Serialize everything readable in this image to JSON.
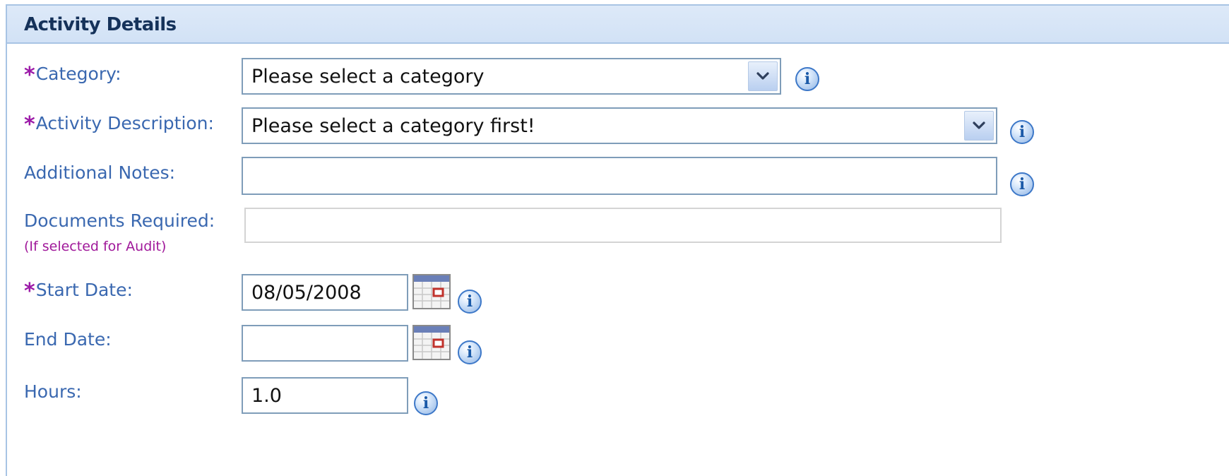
{
  "panel": {
    "title": "Activity Details"
  },
  "fields": {
    "category": {
      "required_mark": "*",
      "label": "Category:",
      "value": "Please select a category"
    },
    "activity_description": {
      "required_mark": "*",
      "label": "Activity Description:",
      "value": "Please select a category first!"
    },
    "additional_notes": {
      "label": "Additional Notes:",
      "value": ""
    },
    "documents_required": {
      "label": "Documents Required:",
      "sublabel": "(If selected for Audit)",
      "value": ""
    },
    "start_date": {
      "required_mark": "*",
      "label": "Start Date:",
      "value": "08/05/2008"
    },
    "end_date": {
      "label": "End Date:",
      "value": ""
    },
    "hours": {
      "label": "Hours:",
      "value": "1.0"
    }
  },
  "icons": {
    "info": "info-icon",
    "calendar": "calendar-icon",
    "dropdown": "chevron-down-icon",
    "info_glyph": "i"
  },
  "colors": {
    "label": "#3a68b0",
    "required": "#9c1aa8",
    "header_bg": "#d2e2f6",
    "header_text": "#15325a"
  }
}
